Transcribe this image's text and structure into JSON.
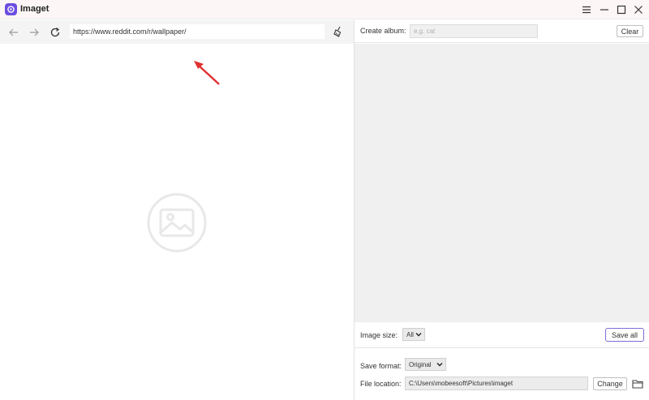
{
  "app": {
    "title": "Imaget"
  },
  "browser": {
    "url": "https://www.reddit.com/r/wallpaper/"
  },
  "album": {
    "label": "Create album:",
    "placeholder": "e.g. cat",
    "clear_label": "Clear"
  },
  "image_size": {
    "label": "Image size:",
    "value": "All",
    "save_all_label": "Save all"
  },
  "save_format": {
    "label": "Save format:",
    "value": "Original"
  },
  "file_location": {
    "label": "File location:",
    "path": "C:\\Users\\mobeesoft\\Pictures\\imaget",
    "change_label": "Change"
  },
  "colors": {
    "accent": "#6b4ee0",
    "annotation": "#e03030",
    "gallery_bg": "#f0f0f0"
  },
  "icons": [
    "app-logo-icon",
    "menu-icon",
    "minimize-icon",
    "maximize-icon",
    "close-icon",
    "back-arrow-icon",
    "forward-arrow-icon",
    "refresh-icon",
    "broom-icon",
    "placeholder-image-icon",
    "chevron-down-icon",
    "folder-icon"
  ]
}
